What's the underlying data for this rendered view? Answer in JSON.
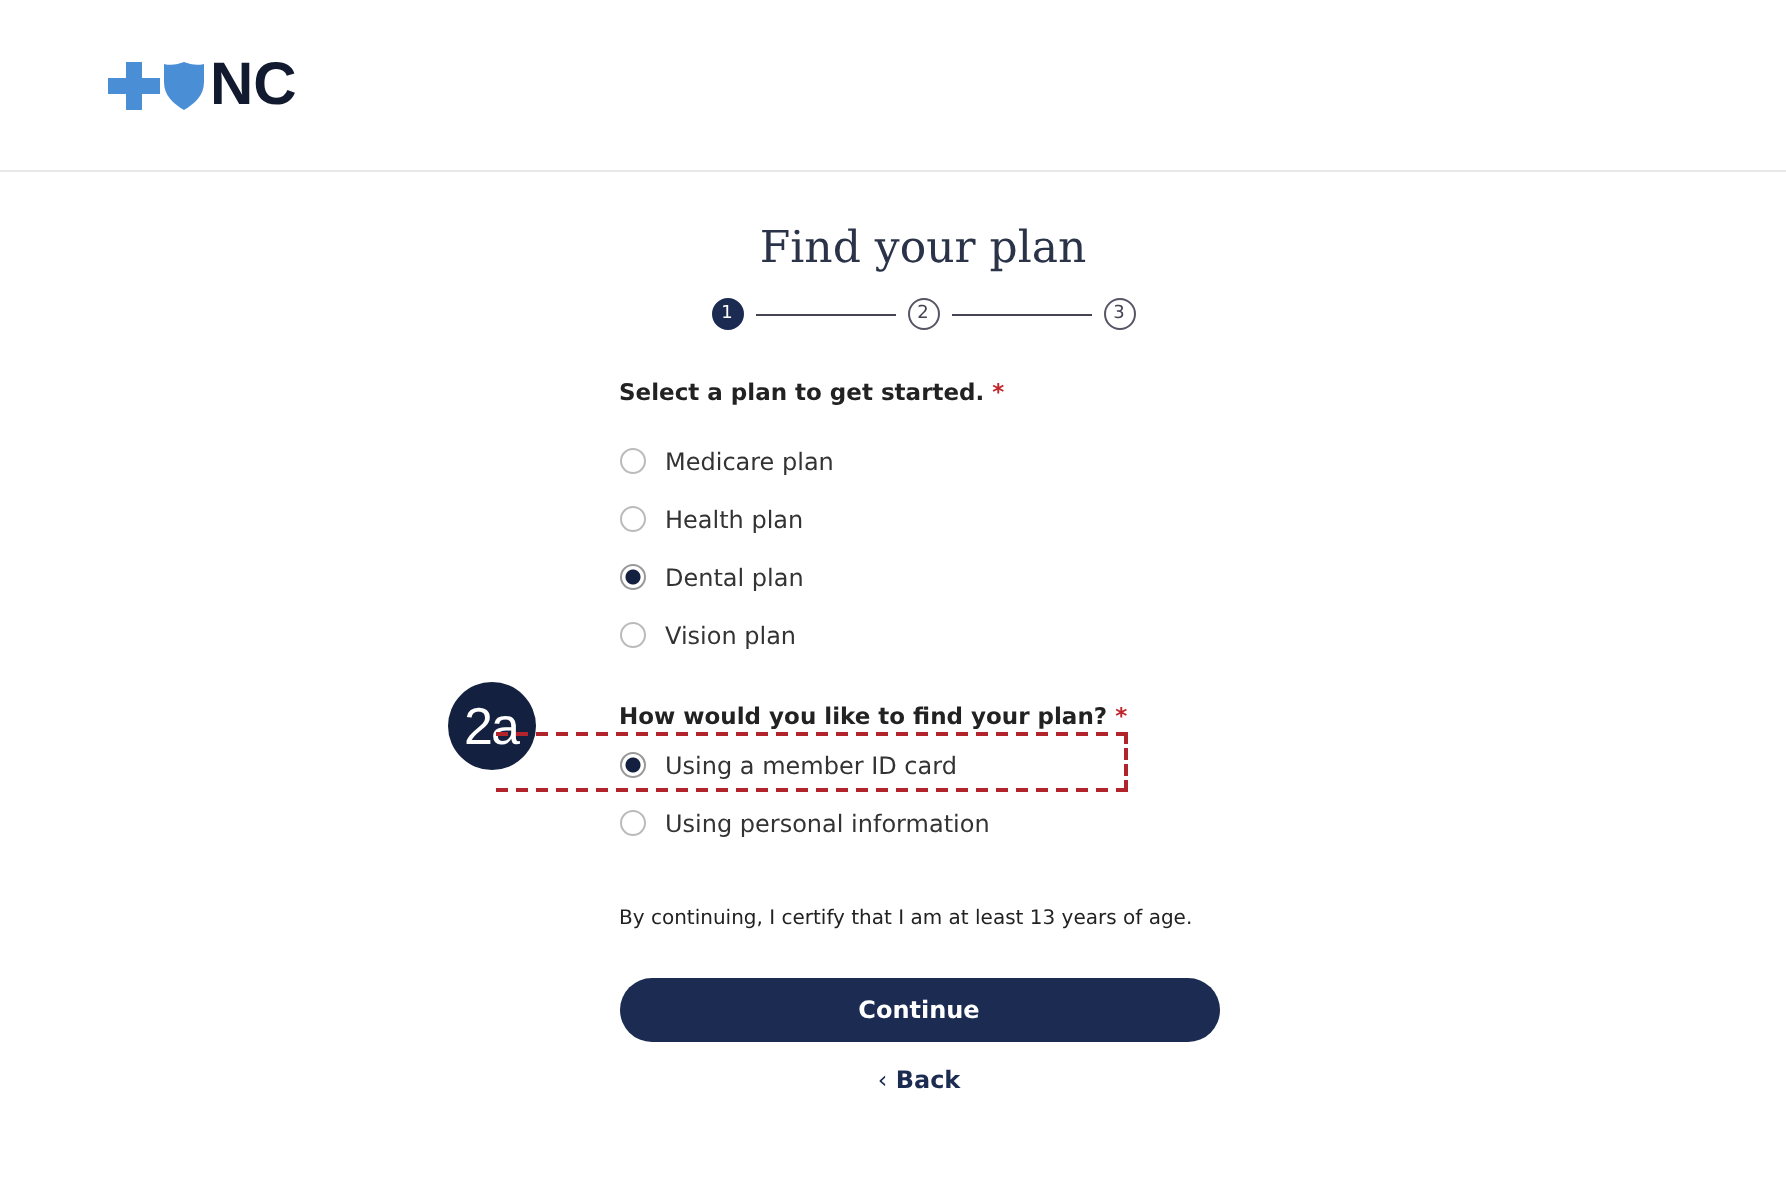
{
  "header": {
    "logo_text": "NC"
  },
  "title": "Find your plan",
  "steps": [
    {
      "label": "1",
      "selected": true
    },
    {
      "label": "2",
      "selected": false
    },
    {
      "label": "3",
      "selected": false
    }
  ],
  "plan_question": {
    "label": "Select a plan to get started.",
    "required_mark": "*"
  },
  "plan_options": [
    {
      "label": "Medicare plan",
      "selected": false
    },
    {
      "label": "Health plan",
      "selected": false
    },
    {
      "label": "Dental plan",
      "selected": true
    },
    {
      "label": "Vision plan",
      "selected": false
    }
  ],
  "find_question": {
    "label": "How would you like to find your plan?",
    "required_mark": "*"
  },
  "find_options": [
    {
      "label": "Using a member ID card",
      "selected": true,
      "highlighted": true
    },
    {
      "label": "Using personal information",
      "selected": false,
      "highlighted": false
    }
  ],
  "callout": {
    "label": "2a"
  },
  "disclaimer": "By continuing, I certify that I am at least 13 years of age.",
  "continue_button": "Continue",
  "back_link": {
    "icon": "‹",
    "label": "Back"
  }
}
